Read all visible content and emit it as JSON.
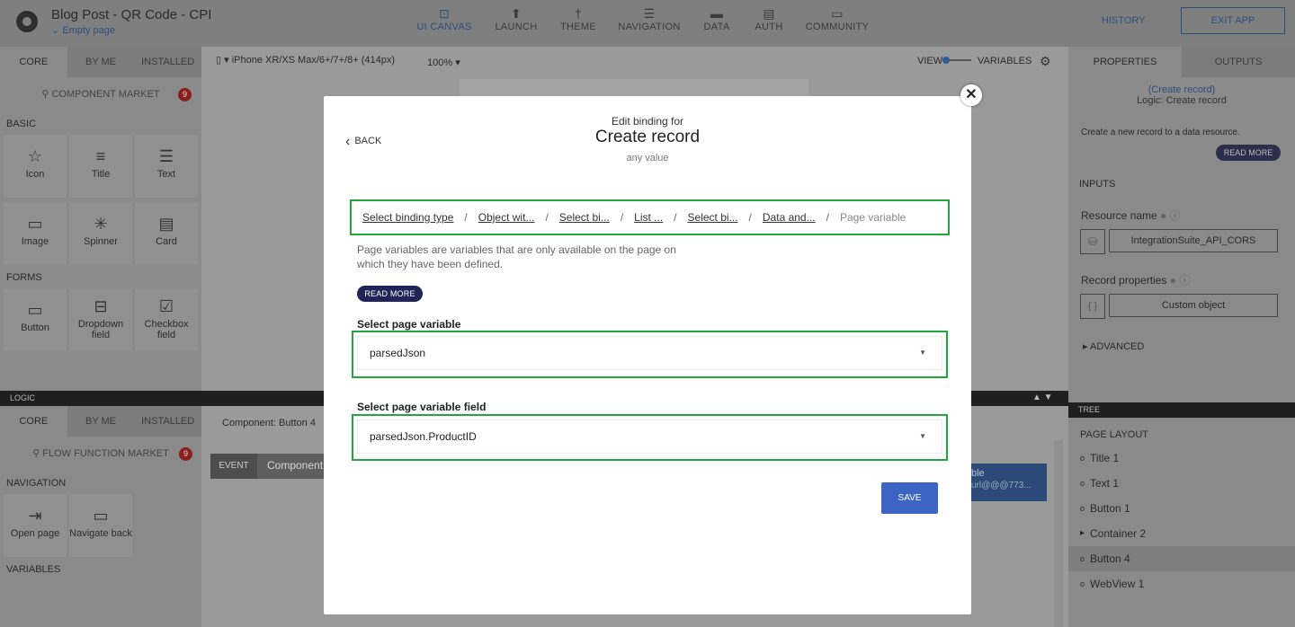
{
  "app": {
    "title": "Blog Post - QR Code - CPI",
    "page": "Empty page"
  },
  "topnav": [
    {
      "label": "UI CANVAS",
      "icon": "canvas-icon"
    },
    {
      "label": "LAUNCH",
      "icon": "rocket-icon"
    },
    {
      "label": "THEME",
      "icon": "brush-icon"
    },
    {
      "label": "NAVIGATION",
      "icon": "list-icon"
    },
    {
      "label": "DATA",
      "icon": "folder-icon"
    },
    {
      "label": "AUTH",
      "icon": "document-lock-icon"
    },
    {
      "label": "COMMUNITY",
      "icon": "chat-icon"
    }
  ],
  "history": "HISTORY",
  "exit": "EXIT APP",
  "left_tabs": [
    "CORE",
    "BY ME",
    "INSTALLED"
  ],
  "component_market": "COMPONENT MARKET",
  "market_badge": "9",
  "sections": {
    "basic": "BASIC",
    "forms": "FORMS",
    "navigation": "NAVIGATION",
    "variables": "VARIABLES"
  },
  "basic_tiles": [
    "Icon",
    "Title",
    "Text",
    "Image",
    "Spinner",
    "Card"
  ],
  "form_tiles": [
    "Button",
    "Dropdown field",
    "Checkbox field"
  ],
  "canvas": {
    "device": "iPhone XR/XS Max/6+/7+/8+ (414px)",
    "zoom": "100%",
    "view": "VIEW",
    "variables": "VARIABLES"
  },
  "properties": {
    "tabs": [
      "PROPERTIES",
      "OUTPUTS"
    ],
    "link": "(Create record)",
    "logic": "Logic: Create record",
    "description": "Create a new record to a data resource.",
    "read_more": "READ MORE",
    "inputs": "INPUTS",
    "resource_label": "Resource name",
    "resource_value": "IntegrationSuite_API_CORS",
    "record_label": "Record properties",
    "record_value": "Custom object",
    "advanced": "ADVANCED"
  },
  "logic": {
    "bar": "LOGIC",
    "component": "Component: Button 4",
    "event": "EVENT",
    "component_trunc": "Component",
    "flow_market": "FLOW FUNCTION MARKET",
    "flow_badge": "9",
    "nav_tiles": [
      "Open page",
      "Navigate back"
    ],
    "node_title": "ble",
    "node_sub": "url@@@773..."
  },
  "tree": {
    "bar": "TREE",
    "layout": "PAGE LAYOUT",
    "items": [
      "Title 1",
      "Text 1",
      "Button 1",
      "Container 2",
      "Button 4",
      "WebView 1"
    ]
  },
  "modal": {
    "back": "BACK",
    "edit_label": "Edit binding for",
    "title": "Create record",
    "subtitle": "any value",
    "crumbs": [
      "Select binding type",
      "Object wit...",
      "Select bi...",
      "List ...",
      "Select bi...",
      "Data and..."
    ],
    "crumb_current": "Page variable",
    "description": "Page variables are variables that are only available on the page on which they have been defined.",
    "read_more": "READ MORE",
    "var_label": "Select page variable",
    "var_value": "parsedJson",
    "field_label": "Select page variable field",
    "field_value": "parsedJson.ProductID",
    "save": "SAVE"
  }
}
